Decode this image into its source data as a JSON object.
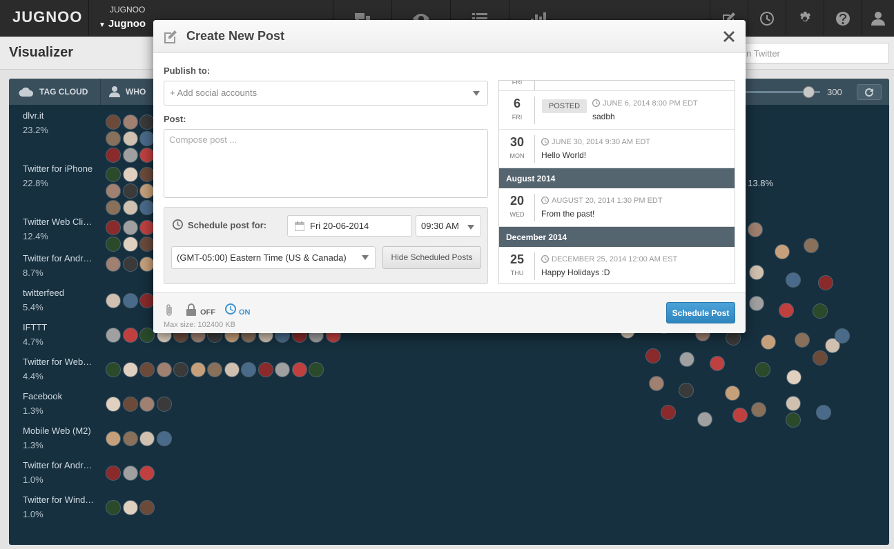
{
  "app": {
    "logo": "JUGNOO",
    "account_small": "JUGNOO",
    "account_name": "Jugnoo"
  },
  "nav": {
    "icons": [
      "chat-bubbles-icon",
      "eye-icon",
      "list-icon",
      "bar-chart-icon"
    ],
    "right_icons": [
      "compose-icon",
      "clock-icon",
      "gear-icon",
      "help-icon",
      "user-icon"
    ]
  },
  "page": {
    "title": "Visualizer",
    "search_placeholder": "n Twitter"
  },
  "panel": {
    "tabs": [
      {
        "label": "TAG CLOUD",
        "icon": "cloud-icon"
      },
      {
        "label": "WHO",
        "icon": "person-icon"
      }
    ],
    "slider_value": "300",
    "slider_level": 0.85,
    "floating_pct": ": 13.8%",
    "sources": [
      {
        "name": "dlvr.it",
        "pct": "23.2%"
      },
      {
        "name": "Twitter for iPhone",
        "pct": "22.8%"
      },
      {
        "name": "Twitter Web Cli…",
        "pct": "12.4%"
      },
      {
        "name": "Twitter for Andr…",
        "pct": "8.7%"
      },
      {
        "name": "twitterfeed",
        "pct": "5.4%"
      },
      {
        "name": "IFTTT",
        "pct": "4.7%"
      },
      {
        "name": "Twitter for Web…",
        "pct": "4.4%"
      },
      {
        "name": "Facebook",
        "pct": "1.3%"
      },
      {
        "name": "Mobile Web (M2)",
        "pct": "1.3%"
      },
      {
        "name": "Twitter for Andr…",
        "pct": "1.0%"
      },
      {
        "name": "Twitter for Wind…",
        "pct": "1.0%"
      }
    ]
  },
  "modal": {
    "title": "Create New Post",
    "publish_label": "Publish to:",
    "accounts_placeholder": "+ Add social accounts",
    "post_label": "Post:",
    "post_placeholder": "Compose post ...",
    "schedule_label": "Schedule post for:",
    "date": "Fri 20-06-2014",
    "time": "09:30 AM",
    "timezone": "(GMT-05:00) Eastern Time (US & Canada)",
    "hide_button": "Hide Scheduled Posts",
    "scheduled": [
      {
        "day": "6",
        "dow": "FRI",
        "badge": "POSTED",
        "meta": "JUNE 6, 2014 8:00 PM EDT",
        "text": "sadbh"
      },
      {
        "day": "30",
        "dow": "MON",
        "meta": "JUNE 30, 2014 9:30 AM EDT",
        "text": "Hello World!"
      },
      {
        "month": "August 2014"
      },
      {
        "day": "20",
        "dow": "WED",
        "meta": "AUGUST 20, 2014 1:30 PM EDT",
        "text": "From the past!"
      },
      {
        "month": "December 2014"
      },
      {
        "day": "25",
        "dow": "THU",
        "meta": "DECEMBER 25, 2014 12:00 AM EST",
        "text": "Happy Holidays :D"
      }
    ],
    "footer": {
      "lock_state": "OFF",
      "clock_state": "ON",
      "max_size": "Max size: 102400 KB",
      "submit": "Schedule Post"
    }
  },
  "colors": {
    "accent": "#3a93cf",
    "panel_bg": "#17303f",
    "month_bar": "#556570"
  }
}
